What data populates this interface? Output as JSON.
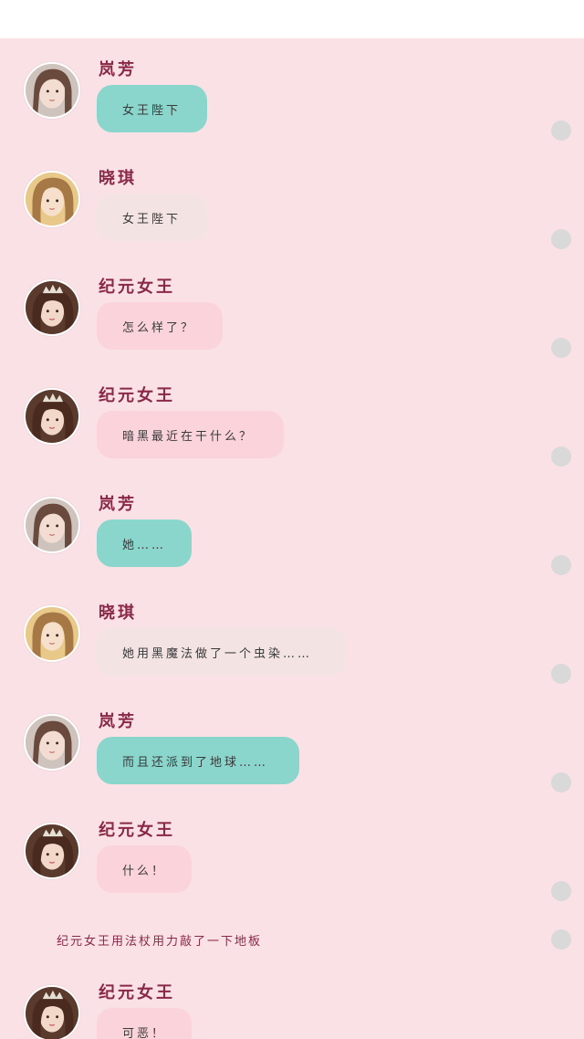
{
  "messages": [
    {
      "sender": "岚芳",
      "text": "女王陛下",
      "avatar": "lanfang-avatar",
      "bubble": "teal"
    },
    {
      "sender": "晓琪",
      "text": "女王陛下",
      "avatar": "xiaoqi-avatar",
      "bubble": "beige"
    },
    {
      "sender": "纪元女王",
      "text": "怎么样了？",
      "avatar": "queen-avatar",
      "bubble": "pink"
    },
    {
      "sender": "纪元女王",
      "text": "暗黑最近在干什么？",
      "avatar": "queen-avatar",
      "bubble": "pink"
    },
    {
      "sender": "岚芳",
      "text": "她……",
      "avatar": "lanfang-avatar",
      "bubble": "teal"
    },
    {
      "sender": "晓琪",
      "text": "她用黑魔法做了一个虫染……",
      "avatar": "xiaoqi-avatar",
      "bubble": "beige"
    },
    {
      "sender": "岚芳",
      "text": "而且还派到了地球……",
      "avatar": "lanfang-avatar",
      "bubble": "teal"
    },
    {
      "sender": "纪元女王",
      "text": "什么！",
      "avatar": "queen-avatar",
      "bubble": "pink"
    },
    {
      "sender": "纪元女王",
      "text": "可恶！",
      "avatar": "queen-avatar",
      "bubble": "pink"
    }
  ],
  "narration": "纪元女王用法杖用力敲了一下地板",
  "colors": {
    "background": "#f9e1e6",
    "sender": "#8a2848",
    "teal_bubble": "#8ad6cc",
    "beige_bubble": "#f3e3e3",
    "pink_bubble": "#fbd3da",
    "radio": "#d9d9d9"
  }
}
